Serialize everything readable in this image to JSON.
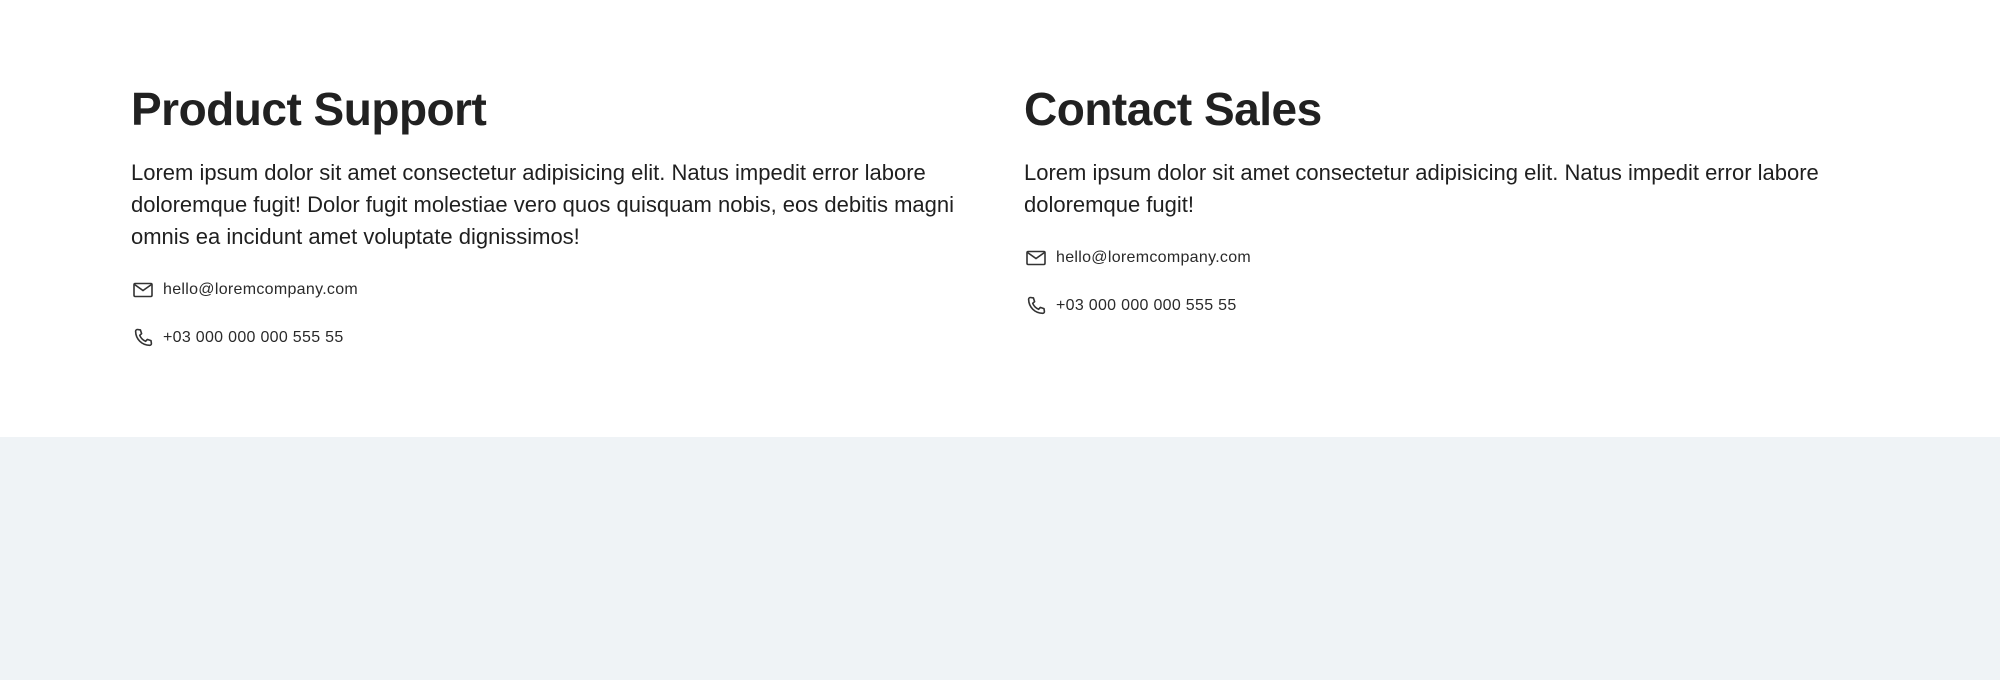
{
  "sections": [
    {
      "title": "Product Support",
      "description": "Lorem ipsum dolor sit amet consectetur adipisicing elit. Natus impedit error labore doloremque fugit! Dolor fugit molestiae vero quos quisquam nobis, eos debitis magni omnis ea incidunt amet voluptate dignissimos!",
      "email": "hello@loremcompany.com",
      "phone": "+03 000 000 000 555 55",
      "email_icon": "mail-icon",
      "phone_icon": "phone-icon"
    },
    {
      "title": "Contact Sales",
      "description": "Lorem ipsum dolor sit amet consectetur adipisicing elit. Natus impedit error labore doloremque fugit!",
      "email": "hello@loremcompany.com",
      "phone": "+03 000 000 000 555 55",
      "email_icon": "mail-icon",
      "phone_icon": "phone-icon"
    }
  ],
  "colors": {
    "heading": "#212121",
    "text": "#1f1f1f",
    "footer_background": "#eff3f6"
  }
}
